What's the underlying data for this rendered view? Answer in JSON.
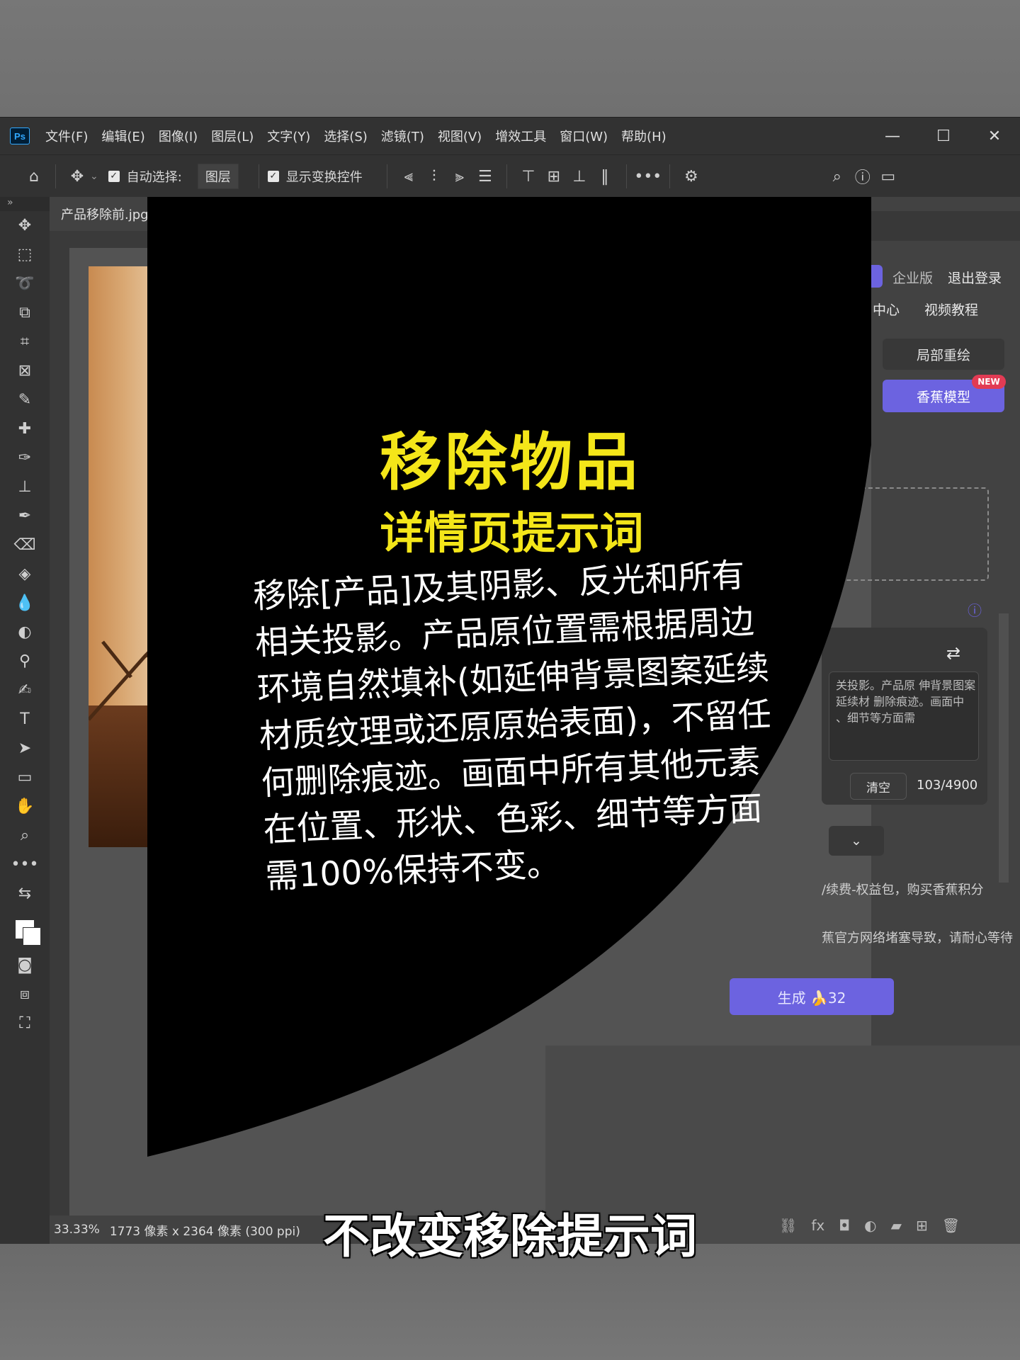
{
  "menubar": {
    "app_icon": "Ps",
    "items": [
      "文件(F)",
      "编辑(E)",
      "图像(I)",
      "图层(L)",
      "文字(Y)",
      "选择(S)",
      "滤镜(T)",
      "视图(V)",
      "增效工具",
      "窗口(W)",
      "帮助(H)"
    ]
  },
  "options": {
    "auto_select_label": "自动选择:",
    "auto_select_value": "图层",
    "transform_label": "显示变换控件"
  },
  "document": {
    "tab_title": "产品移除前.jpg",
    "zoom": "33.33%",
    "info": "1773 像素 x 2364 像素 (300 ppi)"
  },
  "plugin": {
    "enterprise": "企业版",
    "logout": "退出登录",
    "center_tab": "中心",
    "video_tab": "视频教程",
    "local_redraw": "局部重绘",
    "banana_model": "香蕉模型",
    "new_badge": "NEW",
    "prompt_preview": "关投影。产品原 伸背景图案延续材 删除痕迹。画面中 、细节等方面需",
    "clear_button": "清空",
    "char_count": "103/4900",
    "notice_1": "/续费-权益包，购买香蕉积分",
    "notice_2": "蕉官方网络堵塞导致，请耐心等待",
    "generate": "生成 🍌32",
    "translate_icon": "translate-icon"
  },
  "overlay": {
    "title": "移除物品",
    "subtitle": "详情页提示词",
    "body": "移除[产品]及其阴影、反光和所有相关投影。产品原位置需根据周边环境自然填补(如延伸背景图案延续材质纹理或还原原始表面)，不留任何删除痕迹。画面中所有其他元素在位置、形状、色彩、细节等方面需100%保持不变。"
  },
  "caption": "不改变移除提示词",
  "colors": {
    "accent_yellow": "#f4e619",
    "ps_dark": "#323232",
    "plugin_purple": "#6c63e0"
  }
}
